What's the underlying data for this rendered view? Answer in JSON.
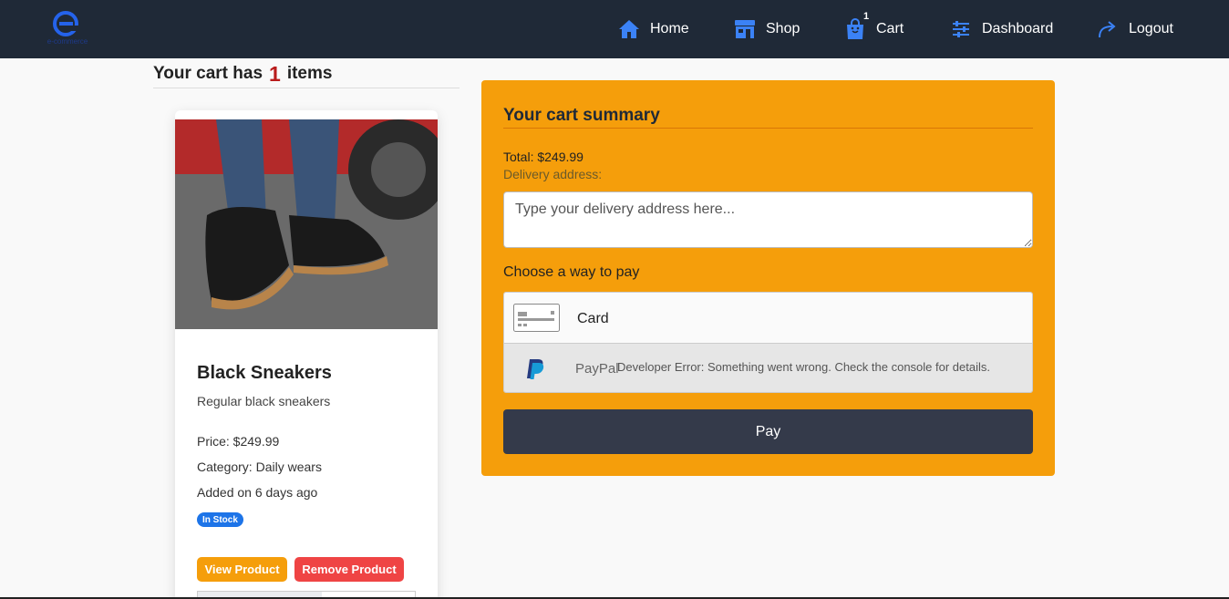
{
  "brand": {
    "logo_text": "e-commerce",
    "accent": "#2563eb"
  },
  "nav": {
    "home": "Home",
    "shop": "Shop",
    "cart": "Cart",
    "cart_count": "1",
    "dashboard": "Dashboard",
    "logout": "Logout"
  },
  "cart": {
    "heading_prefix": "Your cart has",
    "count": "1",
    "heading_suffix": "items"
  },
  "product": {
    "title": "Black Sneakers",
    "description": "Regular black sneakers",
    "price": "Price: $249.99",
    "category": "Category: Daily wears",
    "added": "Added on 6 days ago",
    "stock": "In Stock",
    "view_label": "View Product",
    "remove_label": "Remove Product"
  },
  "summary": {
    "title": "Your cart summary",
    "total": "Total: $249.99",
    "delivery_label": "Delivery address:",
    "address_placeholder": "Type your delivery address here...",
    "pay_way": "Choose a way to pay",
    "options": {
      "card": "Card",
      "paypal": "PayPal",
      "paypal_error": "Developer Error: Something went wrong. Check the console for details."
    },
    "pay_button": "Pay"
  },
  "colors": {
    "navbar": "#1f2937",
    "summary_bg": "#f59e0b",
    "pay_button": "#343a4a",
    "view_button": "#f59e0b",
    "remove_button": "#ef4444",
    "stock_badge": "#1d74e8"
  }
}
